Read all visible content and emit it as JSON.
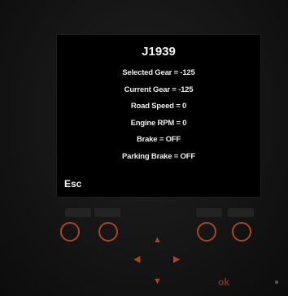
{
  "screen": {
    "title": "J1939",
    "lines": [
      "Selected Gear = -125",
      "Current Gear = -125",
      "Road Speed = 0",
      "Engine RPM = 0",
      "Brake = OFF",
      "Parking Brake = OFF"
    ],
    "esc_label": "Esc"
  },
  "keypad": {
    "ok_label": "ok",
    "arrow_up": "▲",
    "arrow_left": "◀",
    "arrow_right": "▶",
    "arrow_down": "▼"
  },
  "colors": {
    "key_accent": "#a8461f",
    "screen_text": "#ececec",
    "screen_bg": "#000000"
  }
}
